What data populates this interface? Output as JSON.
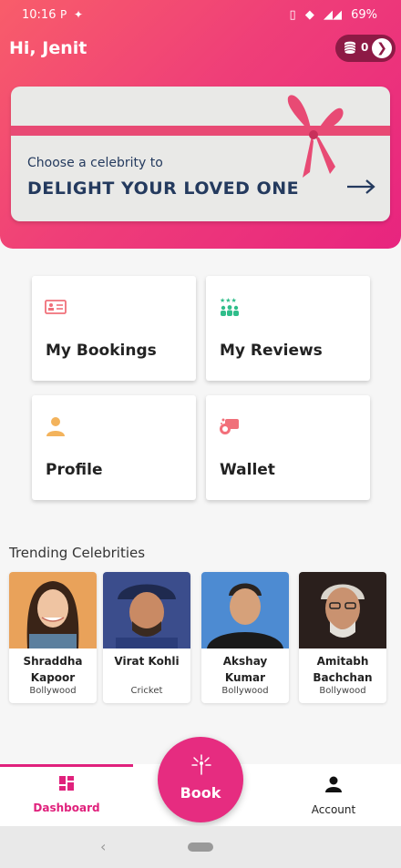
{
  "status": {
    "time": "10:16",
    "battery": "69%"
  },
  "greeting": "Hi, Jenit",
  "wallet": {
    "coins": "0"
  },
  "banner": {
    "subtitle": "Choose a celebrity to",
    "title": "DELIGHT YOUR LOVED ONE"
  },
  "menu": {
    "bookings": "My Bookings",
    "reviews": "My Reviews",
    "profile": "Profile",
    "wallet": "Wallet"
  },
  "trending": {
    "title": "Trending Celebrities",
    "items": [
      {
        "name": "Shraddha Kapoor",
        "category": "Bollywood"
      },
      {
        "name": "Virat Kohli",
        "category": "Cricket"
      },
      {
        "name": "Akshay Kumar",
        "category": "Bollywood"
      },
      {
        "name": "Amitabh Bachchan",
        "category": "Bollywood"
      }
    ]
  },
  "tabs": {
    "dashboard": "Dashboard",
    "book": "Book",
    "account": "Account"
  },
  "colors": {
    "accent": "#e62c80",
    "navy": "#243a5e",
    "ribbon": "#e84a74",
    "wallet_pill": "#8d1a45"
  }
}
